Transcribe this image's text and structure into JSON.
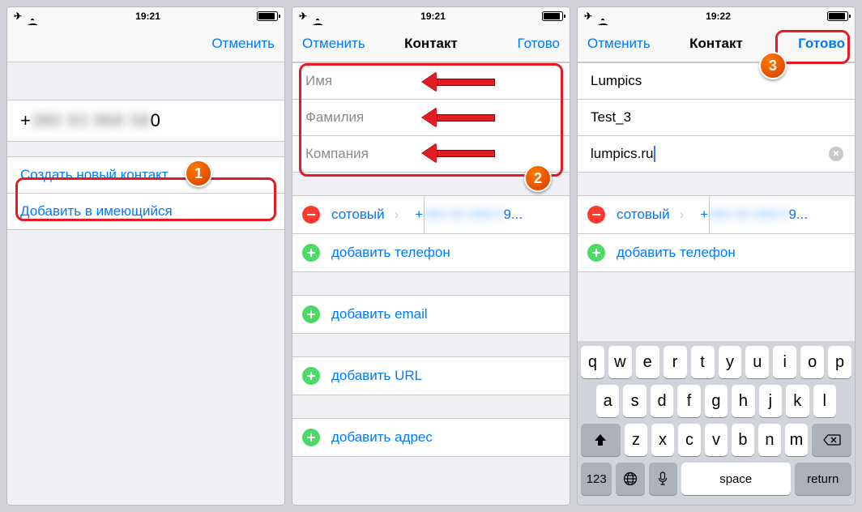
{
  "status": {
    "time1": "19:21",
    "time2": "19:21",
    "time3": "19:22"
  },
  "screen1": {
    "cancel": "Отменить",
    "number_prefix": "+",
    "number_blur": "380 93 968 58",
    "number_suffix": "0",
    "create": "Создать новый контакт",
    "addto": "Добавить в имеющийся"
  },
  "screen2": {
    "cancel": "Отменить",
    "title": "Контакт",
    "done": "Готово",
    "firstname_ph": "Имя",
    "lastname_ph": "Фамилия",
    "company_ph": "Компания",
    "mobile_label": "сотовый",
    "mobile_prefix": "+",
    "mobile_blur": "380 93 968 5",
    "mobile_suffix": "9...",
    "add_phone": "добавить телефон",
    "add_email": "добавить email",
    "add_url": "добавить URL",
    "add_addr": "добавить адрес"
  },
  "screen3": {
    "cancel": "Отменить",
    "title": "Контакт",
    "done": "Готово",
    "firstname": "Lumpics",
    "lastname": "Test_3",
    "company": "lumpics.ru",
    "mobile_label": "сотовый",
    "mobile_prefix": "+",
    "mobile_blur": "380 93 968 5",
    "mobile_suffix": "9...",
    "add_phone": "добавить телефон"
  },
  "keyboard": {
    "row1": [
      "q",
      "w",
      "e",
      "r",
      "t",
      "y",
      "u",
      "i",
      "o",
      "p"
    ],
    "row2": [
      "a",
      "s",
      "d",
      "f",
      "g",
      "h",
      "j",
      "k",
      "l"
    ],
    "row3": [
      "z",
      "x",
      "c",
      "v",
      "b",
      "n",
      "m"
    ],
    "n123": "123",
    "space": "space",
    "return": "return"
  },
  "badges": {
    "b1": "1",
    "b2": "2",
    "b3": "3"
  }
}
